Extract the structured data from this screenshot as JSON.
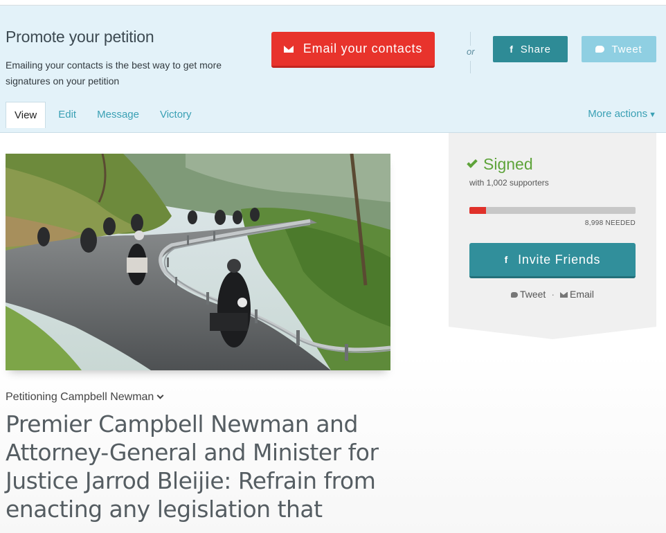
{
  "promo": {
    "title": "Promote your petition",
    "description": "Emailing your contacts is the best way to get more signatures on your petition",
    "email_button": "Email your contacts",
    "or_label": "or",
    "share_button": "Share",
    "tweet_button": "Tweet"
  },
  "tabs": [
    {
      "label": "View",
      "active": true
    },
    {
      "label": "Edit",
      "active": false
    },
    {
      "label": "Message",
      "active": false
    },
    {
      "label": "Victory",
      "active": false
    }
  ],
  "more_actions": "More actions",
  "petition": {
    "photo_icon": "motorcycle-group-photo",
    "petitioning": "Petitioning Campbell Newman",
    "headline": "Premier Campbell Newman and Attorney-General and Minister for Justice Jarrod Bleijie: Refrain from enacting any legislation that"
  },
  "sign_panel": {
    "status": "Signed",
    "supporters": "with 1,002 supporters",
    "progress_fraction": 0.1,
    "needed": "8,998 NEEDED",
    "invite_button": "Invite Friends",
    "tweet_link": "Tweet",
    "separator": "·",
    "email_link": "Email"
  },
  "colors": {
    "promo_bg": "#e3f2f9",
    "email_red": "#e8332c",
    "teal": "#318f9b",
    "tweet_light": "#8fcfe2",
    "signed_green": "#5ea33a",
    "link_teal": "#3aa0b4"
  }
}
